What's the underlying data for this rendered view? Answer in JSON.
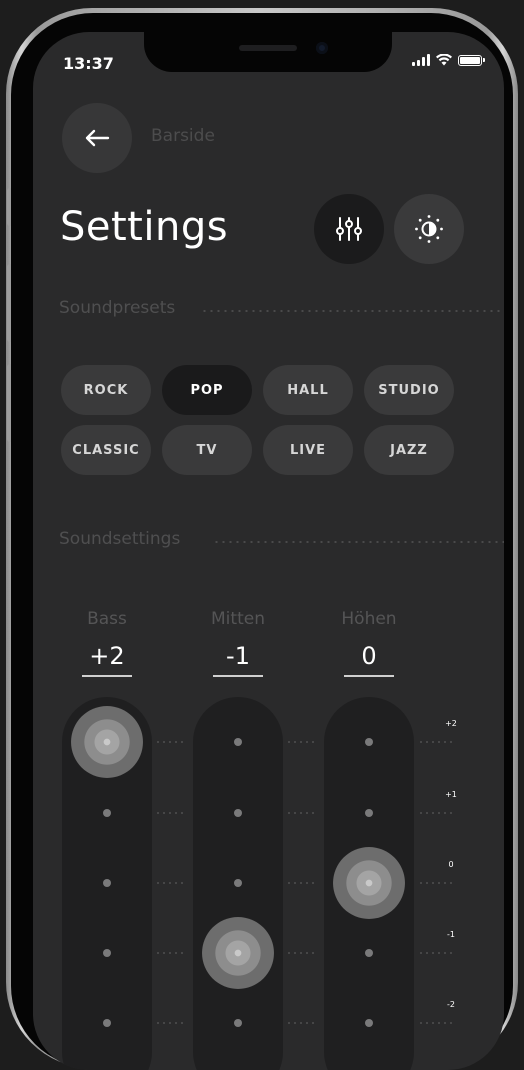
{
  "status_bar": {
    "time": "13:37"
  },
  "header": {
    "back_label": "Barside",
    "title": "Settings"
  },
  "toolbar": {
    "equalizer_icon": "sliders-icon",
    "theme_icon": "contrast-icon"
  },
  "sections": {
    "presets_label": "Soundpresets",
    "settings_label": "Soundsettings"
  },
  "presets": [
    {
      "label": "ROCK",
      "active": false
    },
    {
      "label": "POP",
      "active": true
    },
    {
      "label": "HALL",
      "active": false
    },
    {
      "label": "STUDIO",
      "active": false
    },
    {
      "label": "CLASSIC",
      "active": false
    },
    {
      "label": "TV",
      "active": false
    },
    {
      "label": "LIVE",
      "active": false
    },
    {
      "label": "JAZZ",
      "active": false
    }
  ],
  "bands": [
    {
      "label": "Bass",
      "value_text": "+2",
      "level": 2
    },
    {
      "label": "Mitten",
      "value_text": "-1",
      "level": -1
    },
    {
      "label": "Höhen",
      "value_text": "0",
      "level": 0
    }
  ],
  "scale": [
    "+2",
    "+1",
    "0",
    "-1",
    "-2"
  ],
  "colors": {
    "screen_bg": "#2a2a2b",
    "chip_bg": "#3a3a3b",
    "chip_active_bg": "#1a1a1b",
    "track_bg": "#1f1f20",
    "text": "#ffffff",
    "muted": "#555556"
  }
}
